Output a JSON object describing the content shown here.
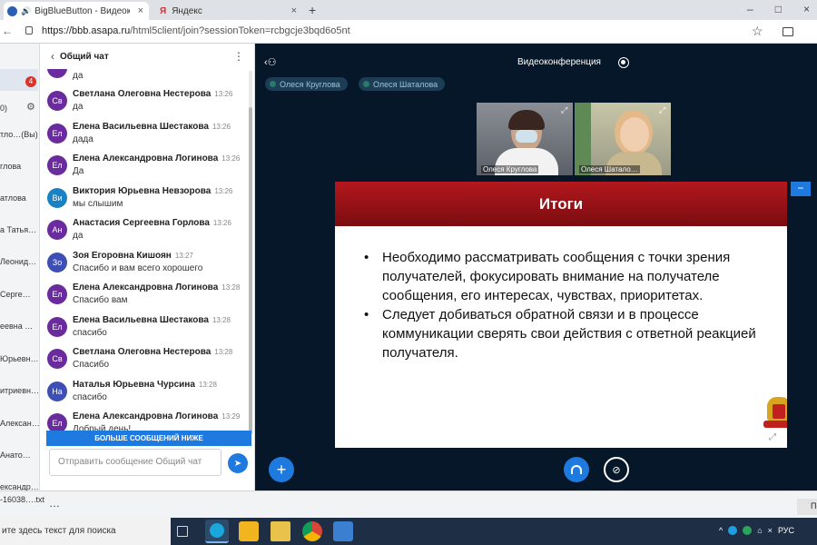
{
  "browser": {
    "tabs": [
      {
        "label": "BigBlueButton - Видеоконф",
        "close": "×"
      },
      {
        "label": "Яндекс",
        "close": "×"
      }
    ],
    "new_tab": "+",
    "url_prefix": "https://bbb.asapa.ru",
    "url_path": "/html5client/join?sessionToken=rcbgcje3bqd6o5nt",
    "nav": {
      "back": "←",
      "reload": "C"
    },
    "star": "☆",
    "window_controls": [
      "–",
      "□",
      "×"
    ]
  },
  "users_panel": {
    "badge": "4",
    "rows": [
      "0)",
      "тло…(Вы)",
      "глова",
      "атлова",
      "а Татья…",
      "Леонид…",
      "Серге…",
      "еевна …",
      "Юрьевн…",
      "итриевн…",
      "Алексан…",
      "Анато…",
      "ександр…"
    ]
  },
  "chat": {
    "title": "Общий чат",
    "first_text": "да",
    "messages": [
      {
        "initials": "Св",
        "name": "Светлана Олеговна Нестерова",
        "time": "13:26",
        "text": "да",
        "color": "#6a2b9e"
      },
      {
        "initials": "Ел",
        "name": "Елена Васильевна Шестакова",
        "time": "13:26",
        "text": "дада",
        "color": "#6a2b9e"
      },
      {
        "initials": "Ел",
        "name": "Елена Александровна Логинова",
        "time": "13:26",
        "text": "Да",
        "color": "#6a2b9e"
      },
      {
        "initials": "Ви",
        "name": "Виктория Юрьевна Невзорова",
        "time": "13:26",
        "text": "мы слышим",
        "color": "#1a82c4"
      },
      {
        "initials": "Ан",
        "name": "Анастасия Сергеевна Горлова",
        "time": "13:26",
        "text": "да",
        "color": "#6a2b9e"
      },
      {
        "initials": "Зо",
        "name": "Зоя Егоровна Кишоян",
        "time": "13:27",
        "text": "Спасибо и вам всего хорошего",
        "color": "#3d4fb5"
      },
      {
        "initials": "Ел",
        "name": "Елена Александровна Логинова",
        "time": "13:28",
        "text": "Спасибо вам",
        "color": "#6a2b9e"
      },
      {
        "initials": "Ел",
        "name": "Елена Васильевна Шестакова",
        "time": "13:28",
        "text": "спасибо",
        "color": "#6a2b9e"
      },
      {
        "initials": "Св",
        "name": "Светлана Олеговна Нестерова",
        "time": "13:28",
        "text": "Спасибо",
        "color": "#6a2b9e"
      },
      {
        "initials": "На",
        "name": "Наталья Юрьевна Чурсина",
        "time": "13:28",
        "text": "спасибо",
        "color": "#3d4fb5"
      },
      {
        "initials": "Ел",
        "name": "Елена Александровна Логинова",
        "time": "13:29",
        "text": "Добрый день!",
        "color": "#6a2b9e"
      }
    ],
    "more_below": "БОЛЬШЕ СООБЩЕНИЙ НИЖЕ",
    "input_placeholder": "Отправить сообщение Общий чат"
  },
  "conference": {
    "title": "Видеоконференция",
    "presenters": [
      "Олеся Круглова",
      "Олеся Шаталова"
    ],
    "videos": [
      {
        "label": "Олеся Круглова"
      },
      {
        "label": "Олеся Шатало…"
      }
    ]
  },
  "slide": {
    "title": "Итоги",
    "bullets": [
      "Необходимо рассматривать сообщения с точки зрения получателей, фокусировать внимание на получателе сообщения, его интересах, чувствах, приоритетах.",
      "Следует добиваться обратной связи и в процессе коммуникации сверять свои действия с ответной реакцией получателя."
    ],
    "minimize": "−"
  },
  "downloads": {
    "file": "-16038….txt",
    "more": "…",
    "right_text": "По"
  },
  "taskbar": {
    "search_placeholder": "ите здесь текст для поиска",
    "language": "РУС"
  }
}
